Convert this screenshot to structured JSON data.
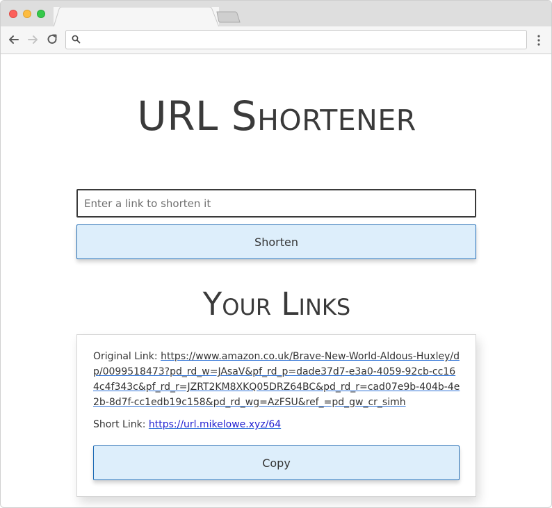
{
  "browser": {
    "address_value": "",
    "icons": [
      "back-arrow-icon",
      "forward-arrow-icon",
      "reload-icon",
      "search-icon",
      "more-menu-icon"
    ],
    "colors": {
      "close": "#fc605b",
      "minimize": "#fdbc40",
      "maximize": "#34c84a"
    }
  },
  "app": {
    "title": "URL Shortener",
    "input_placeholder": "Enter a link to shorten it",
    "input_value": "",
    "shorten_label": "Shorten",
    "links_title": "Your Links",
    "links": [
      {
        "original_label": "Original Link:",
        "original_url": "https://www.amazon.co.uk/Brave-New-World-Aldous-Huxley/dp/0099518473?pd_rd_w=JAsaV&pf_rd_p=dade37d7-e3a0-4059-92cb-cc164c4f343c&pf_rd_r=JZRT2KM8XKQ05DRZ64BC&pd_rd_r=cad07e9b-404b-4e2b-8d7f-cc1edb19c158&pd_rd_wg=AzFSU&ref_=pd_gw_cr_simh",
        "short_label": "Short Link:",
        "short_url": "https://url.mikelowe.xyz/64",
        "copy_label": "Copy"
      }
    ],
    "colors": {
      "button_bg": "#ddeefb",
      "button_border": "#1e6bb5",
      "link_underline": "#2a6fd6"
    }
  }
}
